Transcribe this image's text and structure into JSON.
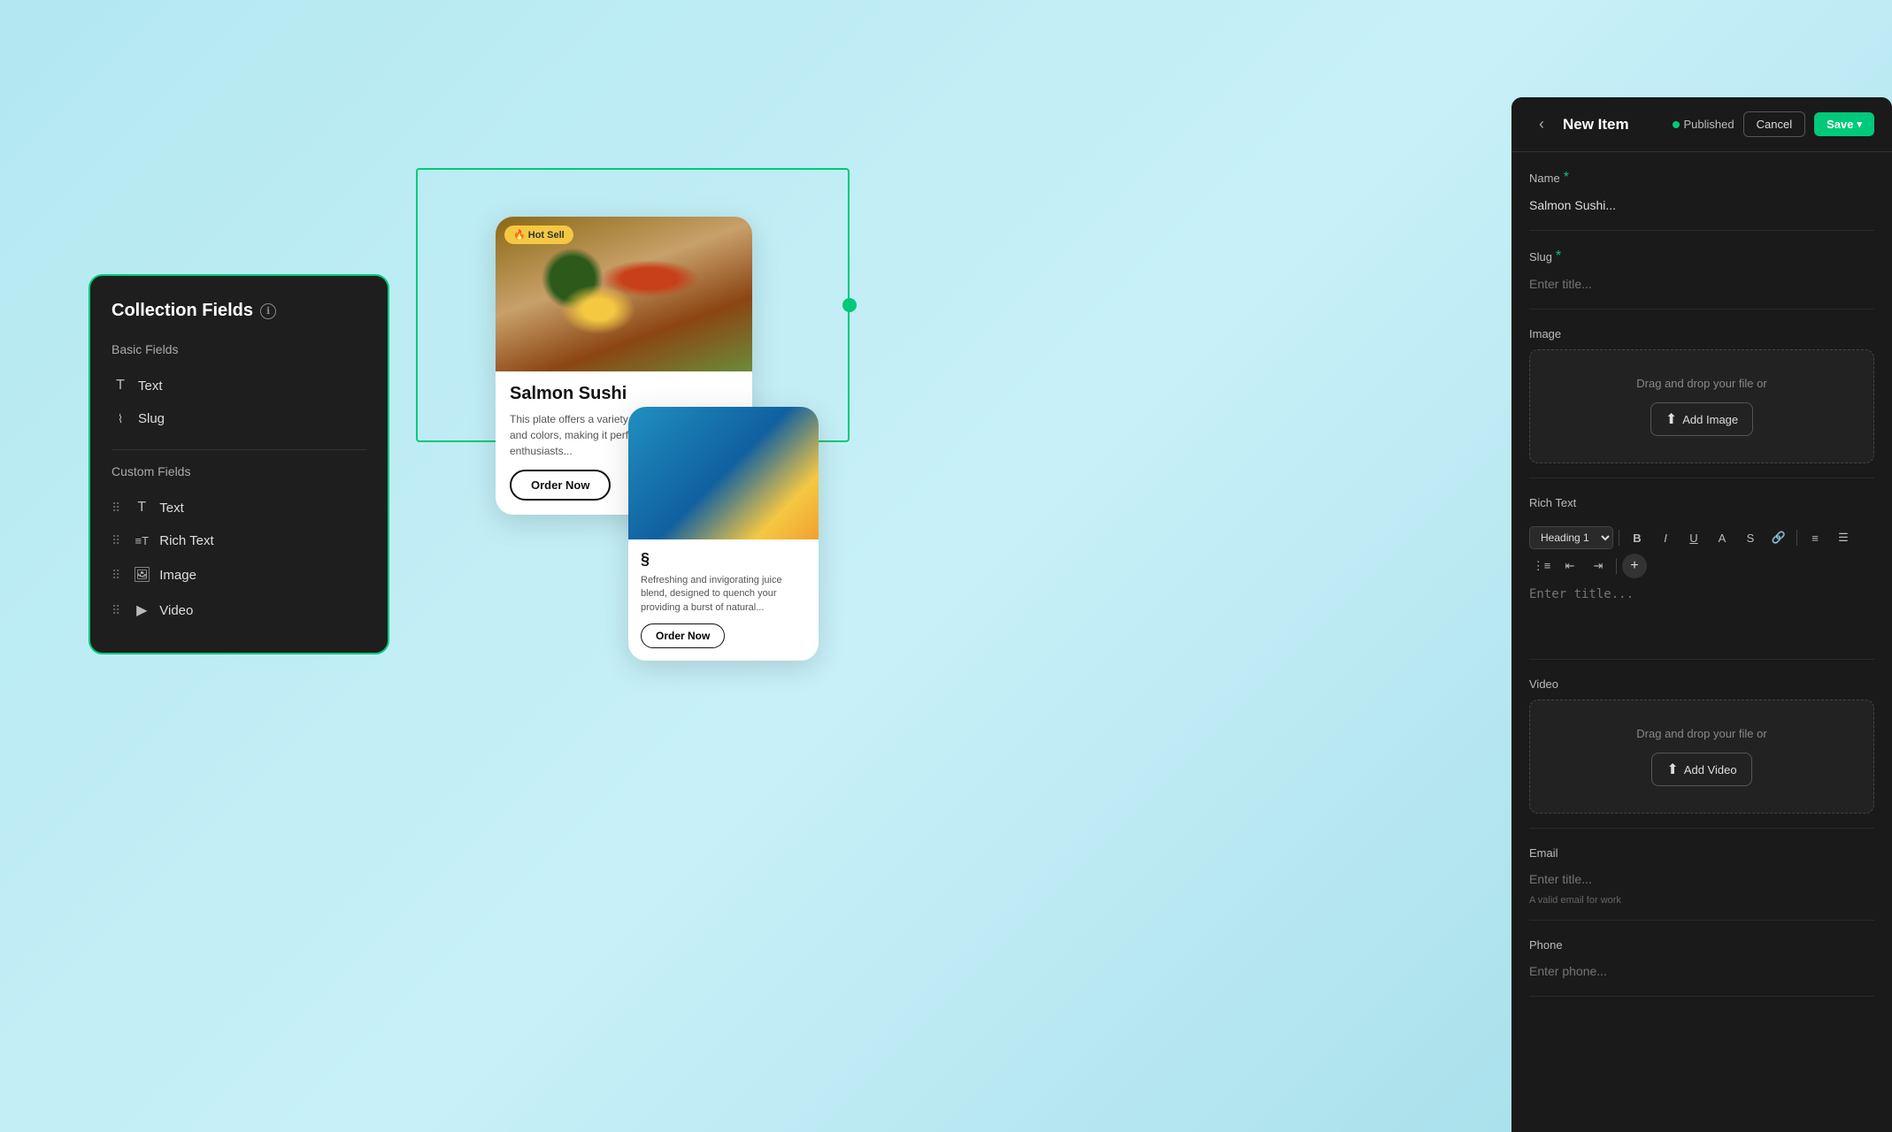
{
  "background": "#b3e8f0",
  "collection_panel": {
    "title": "Collection Fields",
    "info_icon": "ℹ",
    "basic_fields_label": "Basic Fields",
    "basic_fields": [
      {
        "icon": "T",
        "label": "Text"
      },
      {
        "icon": "⋮",
        "label": "Slug"
      }
    ],
    "custom_fields_label": "Custom Fields",
    "custom_fields": [
      {
        "icon": "T",
        "label": "Text"
      },
      {
        "icon": "≡T",
        "label": "Rich Text"
      },
      {
        "icon": "🖼",
        "label": "Image"
      },
      {
        "icon": "▶",
        "label": "Video"
      }
    ]
  },
  "sushi_card": {
    "badge": "🔥 Hot Sell",
    "title": "Salmon Sushi",
    "description": "This plate offers a variety of flavors, textures, and colors, making it perfect for sushi enthusiasts...",
    "order_button": "Order Now"
  },
  "juice_card": {
    "title": "§",
    "description": "Refreshing and invigorating juice blend, designed to quench your providing a burst of natural...",
    "order_button": "Order Now"
  },
  "right_panel": {
    "title": "New Item",
    "back_icon": "‹",
    "published_label": "Published",
    "cancel_label": "Cancel",
    "save_label": "Save",
    "fields": {
      "name": {
        "label": "Name",
        "required": true,
        "value": "Salmon Sushi...",
        "placeholder": "Salmon Sushi..."
      },
      "slug": {
        "label": "Slug",
        "required": true,
        "value": "",
        "placeholder": "Enter title..."
      },
      "image": {
        "label": "Image",
        "upload_text": "Drag and drop your file or",
        "upload_btn": "Add Image"
      },
      "rich_text": {
        "label": "Rich Text",
        "heading_select": "Heading 1",
        "toolbar_buttons": [
          "B",
          "I",
          "U",
          "A",
          "⊞",
          "🔗",
          "≡",
          "☰",
          "⋮≡",
          "⇤",
          "⇥"
        ],
        "placeholder": "Enter title..."
      },
      "video": {
        "label": "Video",
        "upload_text": "Drag and drop your file or",
        "upload_btn": "Add Video"
      },
      "email": {
        "label": "Email",
        "placeholder": "Enter title...",
        "helper": "A valid email for work"
      },
      "phone": {
        "label": "Phone"
      }
    }
  }
}
